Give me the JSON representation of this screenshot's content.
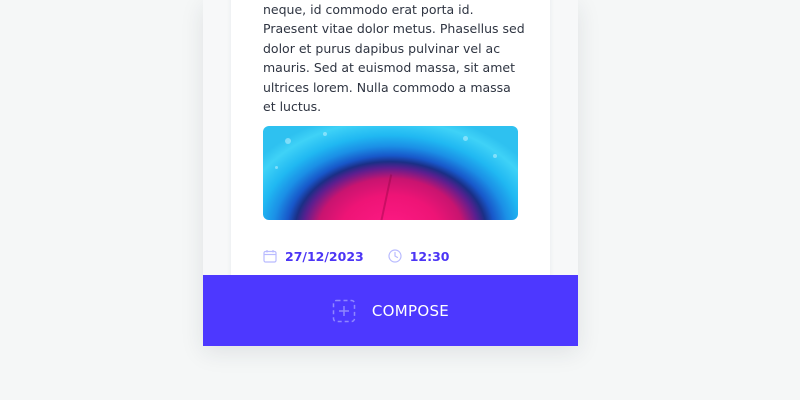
{
  "post": {
    "body": "adipiscing elit. Nullam blandit lacus neque, id commodo erat porta id. Praesent vitae dolor metus. Phasellus sed dolor et purus dapibus pulvinar vel ac mauris. Sed at euismod massa, sit amet ultrices lorem. Nulla commodo a massa et luctus.",
    "image_alt": "abstract pink and blue agate texture",
    "date": "27/12/2023",
    "time": "12:30",
    "icons": {
      "date": "calendar-icon",
      "time": "clock-icon"
    }
  },
  "compose": {
    "label": "COMPOSE",
    "icon": "plus-square-icon"
  },
  "colors": {
    "accent": "#4d38ff",
    "meta_text": "#4c35f5",
    "icon_muted": "#b9bbff",
    "background": "#f5f7f7"
  }
}
